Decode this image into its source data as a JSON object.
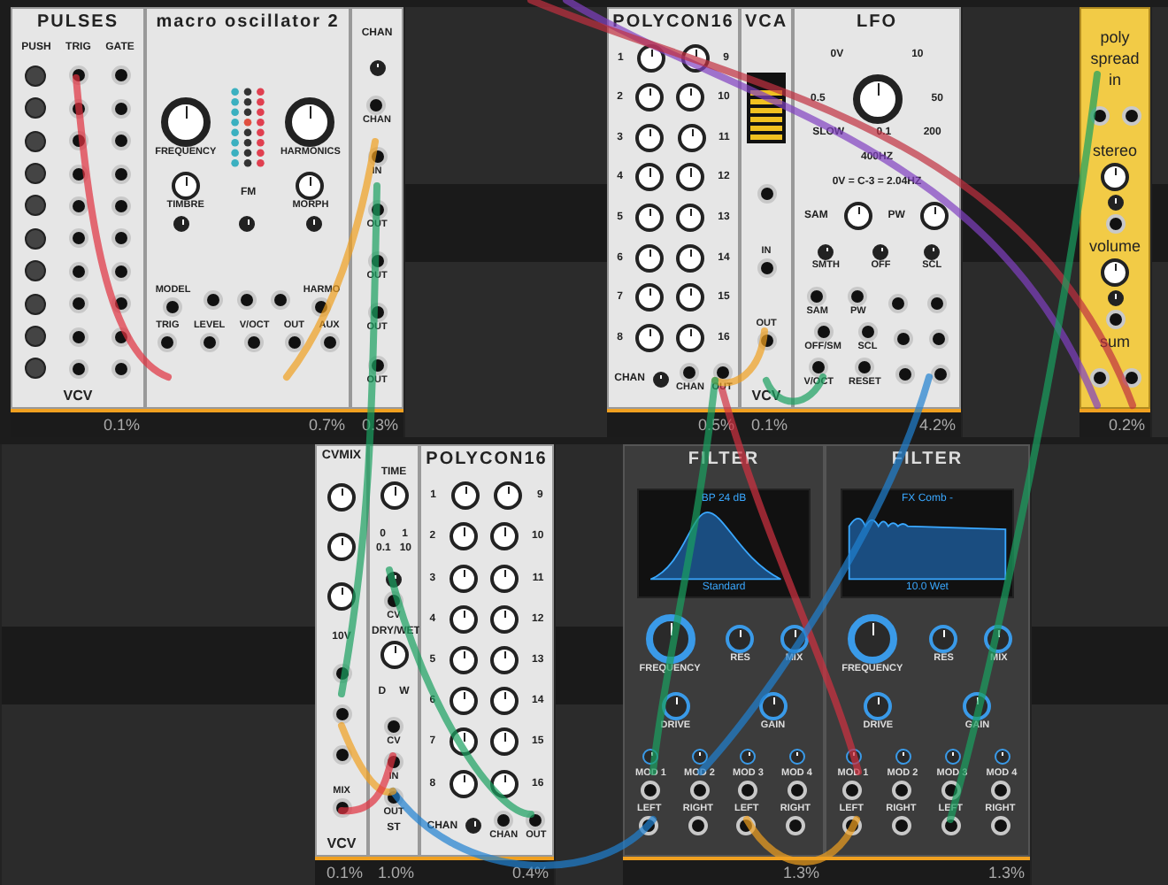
{
  "racks": [
    {
      "modules": [
        {
          "kind": "light",
          "title": "PULSES",
          "meter": "0.1%",
          "logo": "VCV",
          "groups": [
            [
              [
                {
                  "kind": "text",
                  "text": "PUSH"
                },
                {
                  "kind": "text",
                  "text": "TRIG"
                },
                {
                  "kind": "text",
                  "text": "GATE"
                }
              ],
              [
                {
                  "kind": "button"
                },
                {
                  "kind": "jack"
                },
                {
                  "kind": "jack"
                }
              ],
              [
                {
                  "kind": "button"
                },
                {
                  "kind": "jack"
                },
                {
                  "kind": "jack"
                }
              ],
              [
                {
                  "kind": "button"
                },
                {
                  "kind": "jack"
                },
                {
                  "kind": "jack"
                }
              ],
              [
                {
                  "kind": "button"
                },
                {
                  "kind": "jack"
                },
                {
                  "kind": "jack"
                }
              ],
              [
                {
                  "kind": "button"
                },
                {
                  "kind": "jack"
                },
                {
                  "kind": "jack"
                }
              ],
              [
                {
                  "kind": "button"
                },
                {
                  "kind": "jack"
                },
                {
                  "kind": "jack"
                }
              ],
              [
                {
                  "kind": "button"
                },
                {
                  "kind": "jack"
                },
                {
                  "kind": "jack"
                }
              ],
              [
                {
                  "kind": "button"
                },
                {
                  "kind": "jack"
                },
                {
                  "kind": "jack"
                }
              ],
              [
                {
                  "kind": "button"
                },
                {
                  "kind": "jack"
                },
                {
                  "kind": "jack"
                }
              ],
              [
                {
                  "kind": "button"
                },
                {
                  "kind": "jack"
                },
                {
                  "kind": "jack"
                }
              ]
            ]
          ]
        },
        {
          "kind": "light",
          "title": "macro oscillator 2",
          "meter": "0.7%",
          "groups": [
            [
              [
                {
                  "kind": "bigknob",
                  "label": "FREQUENCY"
                },
                {
                  "kind": "leds"
                },
                {
                  "kind": "bigknob",
                  "label": "HARMONICS"
                }
              ],
              [
                {
                  "kind": "knob",
                  "label": "TIMBRE"
                },
                {
                  "kind": "text",
                  "text": "FM"
                },
                {
                  "kind": "knob",
                  "label": "MORPH"
                }
              ],
              [
                {
                  "kind": "smallknob"
                },
                {
                  "kind": "smallknob"
                },
                {
                  "kind": "smallknob"
                }
              ]
            ],
            [
              [
                {
                  "kind": "jack",
                  "caption": "MODEL"
                },
                {
                  "kind": "jack"
                },
                {
                  "kind": "jack"
                },
                {
                  "kind": "jack"
                },
                {
                  "kind": "jack",
                  "caption": "HARMO"
                }
              ],
              [
                {
                  "kind": "jack",
                  "caption": "TRIG"
                },
                {
                  "kind": "jack",
                  "caption": "LEVEL"
                },
                {
                  "kind": "jack",
                  "caption": "V/OCT"
                },
                {
                  "kind": "jack",
                  "caption": "OUT"
                },
                {
                  "kind": "jack",
                  "caption": "AUX"
                }
              ]
            ]
          ]
        },
        {
          "kind": "light",
          "meter": "0.3%",
          "groups": [
            [
              [
                {
                  "kind": "text",
                  "text": "CHAN"
                }
              ],
              [
                {
                  "kind": "smallknob"
                }
              ],
              [
                {
                  "kind": "jack",
                  "label": "CHAN"
                }
              ],
              [
                {
                  "kind": "jack",
                  "label": "IN"
                }
              ],
              [
                {
                  "kind": "jack",
                  "label": "OUT"
                }
              ],
              [
                {
                  "kind": "jack",
                  "label": "OUT"
                }
              ],
              [
                {
                  "kind": "jack",
                  "label": "OUT"
                }
              ],
              [
                {
                  "kind": "jack",
                  "label": "OUT"
                }
              ]
            ]
          ]
        },
        {
          "kind": "blank"
        },
        {
          "kind": "light",
          "title": "POLYCON16",
          "meter": "0.5%",
          "groups": [
            [
              [
                {
                  "kind": "text",
                  "text": "1"
                },
                {
                  "kind": "knob"
                },
                {
                  "kind": "knob"
                },
                {
                  "kind": "text",
                  "text": "9"
                }
              ],
              [
                {
                  "kind": "text",
                  "text": "2"
                },
                {
                  "kind": "knob"
                },
                {
                  "kind": "knob"
                },
                {
                  "kind": "text",
                  "text": "10"
                }
              ],
              [
                {
                  "kind": "text",
                  "text": "3"
                },
                {
                  "kind": "knob"
                },
                {
                  "kind": "knob"
                },
                {
                  "kind": "text",
                  "text": "11"
                }
              ],
              [
                {
                  "kind": "text",
                  "text": "4"
                },
                {
                  "kind": "knob"
                },
                {
                  "kind": "knob"
                },
                {
                  "kind": "text",
                  "text": "12"
                }
              ],
              [
                {
                  "kind": "text",
                  "text": "5"
                },
                {
                  "kind": "knob"
                },
                {
                  "kind": "knob"
                },
                {
                  "kind": "text",
                  "text": "13"
                }
              ],
              [
                {
                  "kind": "text",
                  "text": "6"
                },
                {
                  "kind": "knob"
                },
                {
                  "kind": "knob"
                },
                {
                  "kind": "text",
                  "text": "14"
                }
              ],
              [
                {
                  "kind": "text",
                  "text": "7"
                },
                {
                  "kind": "knob"
                },
                {
                  "kind": "knob"
                },
                {
                  "kind": "text",
                  "text": "15"
                }
              ],
              [
                {
                  "kind": "text",
                  "text": "8"
                },
                {
                  "kind": "knob"
                },
                {
                  "kind": "knob"
                },
                {
                  "kind": "text",
                  "text": "16"
                }
              ],
              [
                {
                  "kind": "text",
                  "text": "CHAN"
                },
                {
                  "kind": "smallknob"
                },
                {
                  "kind": "jack",
                  "label": "CHAN"
                },
                {
                  "kind": "jack",
                  "label": "OUT"
                }
              ]
            ]
          ]
        },
        {
          "kind": "light",
          "title": "VCA",
          "meter": "0.1%",
          "logo": "VCV",
          "groups": [
            [
              [
                {
                  "kind": "bars"
                }
              ],
              [
                {
                  "kind": "jack"
                }
              ],
              [
                {
                  "kind": "jack",
                  "caption": "IN"
                }
              ],
              [
                {
                  "kind": "jack",
                  "caption": "OUT"
                }
              ]
            ]
          ]
        },
        {
          "kind": "light",
          "title": "LFO",
          "meter": "4.2%",
          "groups": [
            [
              [
                {
                  "kind": "text",
                  "text": "0V"
                },
                {
                  "kind": "text",
                  "text": "10"
                }
              ]
            ],
            [
              [
                {
                  "kind": "text",
                  "text": "0.5"
                },
                {
                  "kind": "bigknob"
                },
                {
                  "kind": "text",
                  "text": "50"
                }
              ],
              [
                {
                  "kind": "text",
                  "text": "SLOW"
                },
                {
                  "kind": "text",
                  "text": "0.1"
                },
                {
                  "kind": "text",
                  "text": "200"
                }
              ]
            ],
            [
              [
                {
                  "kind": "text",
                  "text": "400HZ"
                }
              ]
            ],
            [
              [
                {
                  "kind": "text",
                  "text": "0V = C-3 = 2.04HZ"
                }
              ]
            ],
            [
              [
                {
                  "kind": "text",
                  "text": "SAM"
                },
                {
                  "kind": "knob"
                },
                {
                  "kind": "text",
                  "text": "PW"
                },
                {
                  "kind": "knob"
                }
              ]
            ],
            [
              [
                {
                  "kind": "smallknob",
                  "label": "SMTH"
                },
                {
                  "kind": "smallknob",
                  "label": "OFF"
                },
                {
                  "kind": "smallknob",
                  "label": "SCL"
                }
              ]
            ],
            [
              [
                {
                  "kind": "jack",
                  "label": "SAM"
                },
                {
                  "kind": "jack",
                  "label": "PW"
                },
                {
                  "kind": "jack"
                },
                {
                  "kind": "jack"
                }
              ],
              [
                {
                  "kind": "jack",
                  "label": "OFF/SM"
                },
                {
                  "kind": "jack",
                  "label": "SCL"
                },
                {
                  "kind": "jack"
                },
                {
                  "kind": "jack"
                }
              ],
              [
                {
                  "kind": "jack",
                  "label": "V/OCT"
                },
                {
                  "kind": "jack",
                  "label": "RESET"
                },
                {
                  "kind": "jack"
                },
                {
                  "kind": "jack"
                }
              ]
            ]
          ]
        },
        {
          "kind": "blank"
        },
        {
          "kind": "yellow",
          "meter": "0.2%",
          "groups": [
            [
              [
                {
                  "kind": "text",
                  "text": "poly"
                }
              ],
              [
                {
                  "kind": "text",
                  "text": "spread"
                }
              ],
              [
                {
                  "kind": "text",
                  "text": "in"
                }
              ]
            ],
            [
              [
                {
                  "kind": "jack"
                },
                {
                  "kind": "jack"
                }
              ]
            ],
            [
              [
                {
                  "kind": "text",
                  "text": "stereo"
                }
              ],
              [
                {
                  "kind": "knob"
                }
              ],
              [
                {
                  "kind": "smallknob"
                }
              ],
              [
                {
                  "kind": "jack"
                }
              ],
              [
                {
                  "kind": "text",
                  "text": "volume"
                }
              ],
              [
                {
                  "kind": "knob"
                }
              ],
              [
                {
                  "kind": "smallknob"
                }
              ],
              [
                {
                  "kind": "jack"
                }
              ],
              [
                {
                  "kind": "text",
                  "text": "sum"
                }
              ]
            ],
            [
              [
                {
                  "kind": "jack"
                },
                {
                  "kind": "jack"
                }
              ]
            ]
          ]
        },
        {
          "kind": "blank"
        }
      ]
    },
    {
      "modules": [
        {
          "kind": "blank"
        },
        {
          "kind": "light",
          "title": "CVMIX",
          "meter": "0.1%",
          "logo": "VCV",
          "groups": [
            [
              [
                {
                  "kind": "knob"
                }
              ],
              [
                {
                  "kind": "knob"
                }
              ],
              [
                {
                  "kind": "knob"
                }
              ],
              [
                {
                  "kind": "text",
                  "text": "10V"
                }
              ],
              [
                {
                  "kind": "jack"
                }
              ],
              [
                {
                  "kind": "jack"
                }
              ],
              [
                {
                  "kind": "jack"
                }
              ],
              [
                {
                  "kind": "jack",
                  "caption": "MIX"
                }
              ]
            ]
          ]
        },
        {
          "kind": "light",
          "meter": "1.0%",
          "groups": [
            [
              [
                {
                  "kind": "text",
                  "text": "TIME"
                }
              ],
              [
                {
                  "kind": "knob"
                }
              ]
            ],
            [
              [
                {
                  "kind": "text",
                  "text": "0"
                },
                {
                  "kind": "text",
                  "text": "1"
                }
              ],
              [
                {
                  "kind": "text",
                  "text": "0.1"
                },
                {
                  "kind": "text",
                  "text": "10"
                }
              ]
            ],
            [
              [
                {
                  "kind": "smallknob"
                }
              ],
              [
                {
                  "kind": "jack",
                  "label": "CV"
                }
              ],
              [
                {
                  "kind": "text",
                  "text": "DRY/WET"
                }
              ],
              [
                {
                  "kind": "knob"
                }
              ]
            ],
            [
              [
                {
                  "kind": "text",
                  "text": "D"
                },
                {
                  "kind": "text",
                  "text": "W"
                }
              ]
            ],
            [
              [
                {
                  "kind": "jack",
                  "label": "CV"
                }
              ],
              [
                {
                  "kind": "jack",
                  "label": "IN"
                }
              ],
              [
                {
                  "kind": "jack",
                  "label": "OUT"
                }
              ],
              [
                {
                  "kind": "text",
                  "text": "ST"
                }
              ]
            ]
          ]
        },
        {
          "kind": "light",
          "title": "POLYCON16",
          "meter": "0.4%",
          "groups": [
            [
              [
                {
                  "kind": "text",
                  "text": "1"
                },
                {
                  "kind": "knob"
                },
                {
                  "kind": "knob"
                },
                {
                  "kind": "text",
                  "text": "9"
                }
              ],
              [
                {
                  "kind": "text",
                  "text": "2"
                },
                {
                  "kind": "knob"
                },
                {
                  "kind": "knob"
                },
                {
                  "kind": "text",
                  "text": "10"
                }
              ],
              [
                {
                  "kind": "text",
                  "text": "3"
                },
                {
                  "kind": "knob"
                },
                {
                  "kind": "knob"
                },
                {
                  "kind": "text",
                  "text": "11"
                }
              ],
              [
                {
                  "kind": "text",
                  "text": "4"
                },
                {
                  "kind": "knob"
                },
                {
                  "kind": "knob"
                },
                {
                  "kind": "text",
                  "text": "12"
                }
              ],
              [
                {
                  "kind": "text",
                  "text": "5"
                },
                {
                  "kind": "knob"
                },
                {
                  "kind": "knob"
                },
                {
                  "kind": "text",
                  "text": "13"
                }
              ],
              [
                {
                  "kind": "text",
                  "text": "6"
                },
                {
                  "kind": "knob"
                },
                {
                  "kind": "knob"
                },
                {
                  "kind": "text",
                  "text": "14"
                }
              ],
              [
                {
                  "kind": "text",
                  "text": "7"
                },
                {
                  "kind": "knob"
                },
                {
                  "kind": "knob"
                },
                {
                  "kind": "text",
                  "text": "15"
                }
              ],
              [
                {
                  "kind": "text",
                  "text": "8"
                },
                {
                  "kind": "knob"
                },
                {
                  "kind": "knob"
                },
                {
                  "kind": "text",
                  "text": "16"
                }
              ],
              [
                {
                  "kind": "text",
                  "text": "CHAN"
                },
                {
                  "kind": "smallknob"
                },
                {
                  "kind": "jack",
                  "label": "CHAN"
                },
                {
                  "kind": "jack",
                  "label": "OUT"
                }
              ]
            ]
          ]
        },
        {
          "kind": "blank"
        },
        {
          "kind": "dark",
          "title": "FILTER",
          "meter": "1.3%",
          "groups": [
            [
              [
                {
                  "kind": "peakscreen",
                  "top": "BP 24 dB",
                  "bottom": "Standard"
                }
              ]
            ],
            [
              [
                {
                  "kind": "bigknob",
                  "label": "FREQUENCY"
                },
                {
                  "kind": "knob",
                  "label": "RES"
                },
                {
                  "kind": "knob",
                  "label": "MIX"
                }
              ]
            ],
            [
              [
                {
                  "kind": "knob",
                  "label": "DRIVE"
                },
                {
                  "kind": "knob",
                  "label": "GAIN"
                }
              ]
            ],
            [
              [
                {
                  "kind": "smallknob"
                },
                {
                  "kind": "smallknob"
                },
                {
                  "kind": "smallknob"
                },
                {
                  "kind": "smallknob"
                }
              ],
              [
                {
                  "kind": "jack",
                  "caption": "MOD 1"
                },
                {
                  "kind": "jack",
                  "caption": "MOD 2"
                },
                {
                  "kind": "jack",
                  "caption": "MOD 3"
                },
                {
                  "kind": "jack",
                  "caption": "MOD 4"
                }
              ],
              [
                {
                  "kind": "jack",
                  "caption": "LEFT"
                },
                {
                  "kind": "jack",
                  "caption": "RIGHT"
                },
                {
                  "kind": "jack",
                  "caption": "LEFT"
                },
                {
                  "kind": "jack",
                  "caption": "RIGHT"
                }
              ]
            ]
          ]
        },
        {
          "kind": "dark",
          "title": "FILTER",
          "meter": "1.3%",
          "groups": [
            [
              [
                {
                  "kind": "combscreen",
                  "top": "FX Comb -",
                  "bottom": "10.0  Wet"
                }
              ]
            ],
            [
              [
                {
                  "kind": "bigknob",
                  "label": "FREQUENCY"
                },
                {
                  "kind": "knob",
                  "label": "RES"
                },
                {
                  "kind": "knob",
                  "label": "MIX"
                }
              ]
            ],
            [
              [
                {
                  "kind": "knob",
                  "label": "DRIVE"
                },
                {
                  "kind": "knob",
                  "label": "GAIN"
                }
              ]
            ],
            [
              [
                {
                  "kind": "smallknob"
                },
                {
                  "kind": "smallknob"
                },
                {
                  "kind": "smallknob"
                },
                {
                  "kind": "smallknob"
                }
              ],
              [
                {
                  "kind": "jack",
                  "caption": "MOD 1"
                },
                {
                  "kind": "jack",
                  "caption": "MOD 2"
                },
                {
                  "kind": "jack",
                  "caption": "MOD 3"
                },
                {
                  "kind": "jack",
                  "caption": "MOD 4"
                }
              ],
              [
                {
                  "kind": "jack",
                  "caption": "LEFT"
                },
                {
                  "kind": "jack",
                  "caption": "RIGHT"
                },
                {
                  "kind": "jack",
                  "caption": "LEFT"
                },
                {
                  "kind": "jack",
                  "caption": "RIGHT"
                }
              ]
            ]
          ]
        },
        {
          "kind": "blank"
        }
      ]
    }
  ]
}
